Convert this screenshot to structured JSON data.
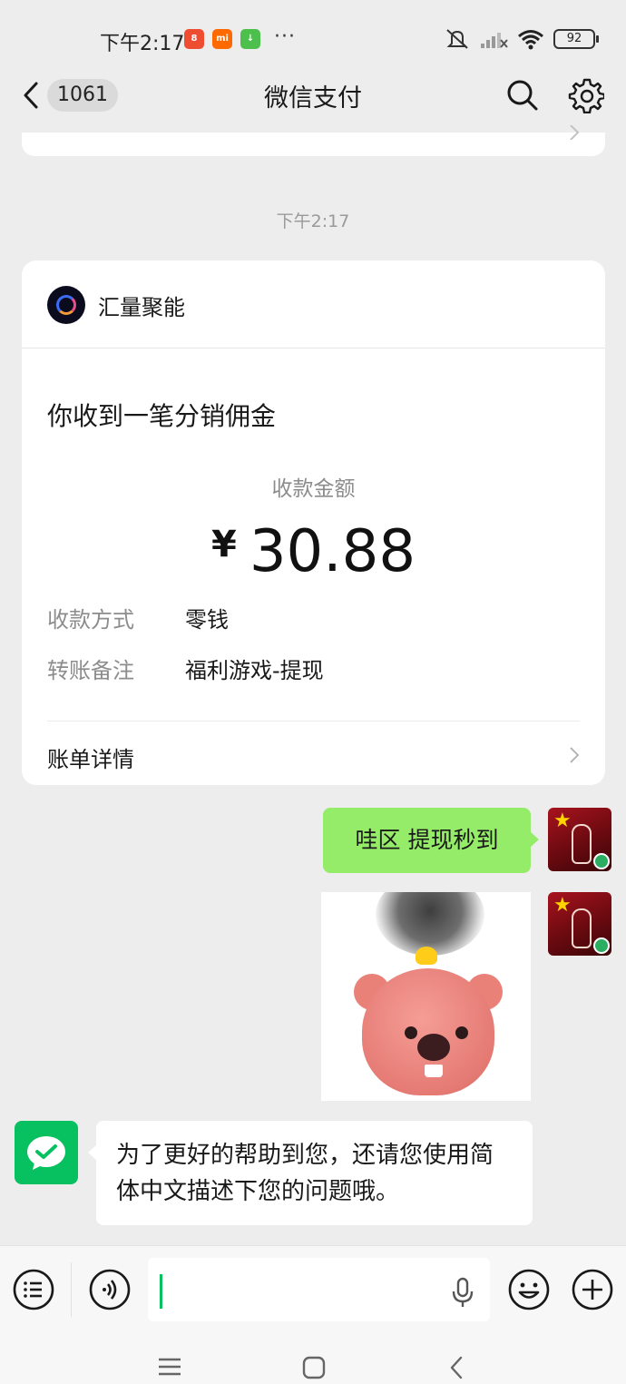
{
  "status_bar": {
    "time": "下午2:17",
    "apps": [
      {
        "name": "app-icon-1",
        "label": "8",
        "color": "#ef4d31"
      },
      {
        "name": "app-icon-mi",
        "label": "mi",
        "color": "#ff6a00"
      },
      {
        "name": "app-icon-download",
        "label": "↓",
        "color": "#4cbf4c"
      }
    ],
    "more": "···",
    "battery": "92"
  },
  "nav": {
    "unread_count": "1061",
    "title": "微信支付"
  },
  "timestamp": "下午2:17",
  "payment_card": {
    "merchant": "汇量聚能",
    "headline": "你收到一笔分销佣金",
    "amount_label": "收款金额",
    "currency": "¥",
    "amount": "30.88",
    "details": [
      {
        "key": "收款方式",
        "value": "零钱"
      },
      {
        "key": "转账备注",
        "value": "福利游戏-提现"
      }
    ],
    "bill_label": "账单详情"
  },
  "messages": {
    "outgoing_text": "哇区 提现秒到",
    "incoming_text": "为了更好的帮助到您，还请您使用简体中文描述下您的问题哦。"
  },
  "colors": {
    "accent": "#07c160",
    "outgoing_bubble": "#95ec69",
    "background": "#ededed"
  }
}
